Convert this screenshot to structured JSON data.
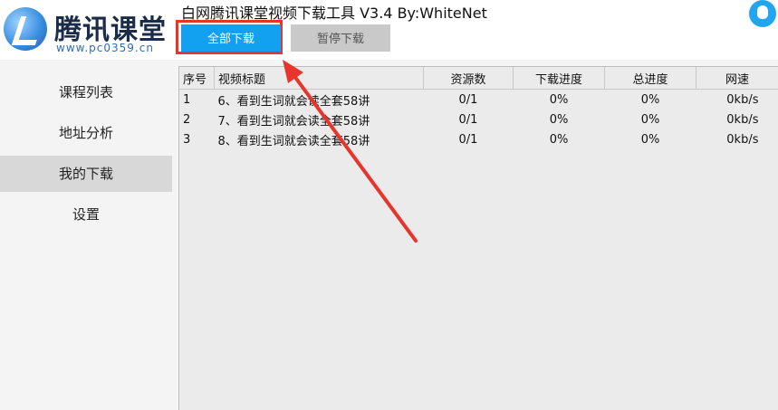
{
  "header": {
    "logo_text": "腾讯课堂",
    "logo_sub": "www.pc0359.cn",
    "app_title": "白网腾讯课堂视频下载工具 V3.4 By:WhiteNet",
    "buttons": {
      "download_all": "全部下载",
      "pause": "暂停下载"
    }
  },
  "sidebar": {
    "items": [
      {
        "label": "课程列表",
        "active": false
      },
      {
        "label": "地址分析",
        "active": false
      },
      {
        "label": "我的下载",
        "active": true
      },
      {
        "label": "设置",
        "active": false
      }
    ]
  },
  "table": {
    "columns": [
      "序号",
      "视频标题",
      "资源数",
      "下载进度",
      "总进度",
      "网速"
    ],
    "rows": [
      {
        "idx": "1",
        "title": "6、看到生词就会读全套58讲",
        "resources": "0/1",
        "progress": "0%",
        "total": "0%",
        "speed": "0kb/s"
      },
      {
        "idx": "2",
        "title": "7、看到生词就会读全套58讲",
        "resources": "0/1",
        "progress": "0%",
        "total": "0%",
        "speed": "0kb/s"
      },
      {
        "idx": "3",
        "title": "8、看到生词就会读全套58讲",
        "resources": "0/1",
        "progress": "0%",
        "total": "0%",
        "speed": "0kb/s"
      }
    ]
  },
  "colors": {
    "accent": "#12a0f0",
    "annotation_red": "#e8352c",
    "sidebar_active": "#d8d8d8"
  },
  "icons": {
    "logo": "tencent-classroom-logo-icon",
    "qq": "qq-penguin-icon"
  }
}
